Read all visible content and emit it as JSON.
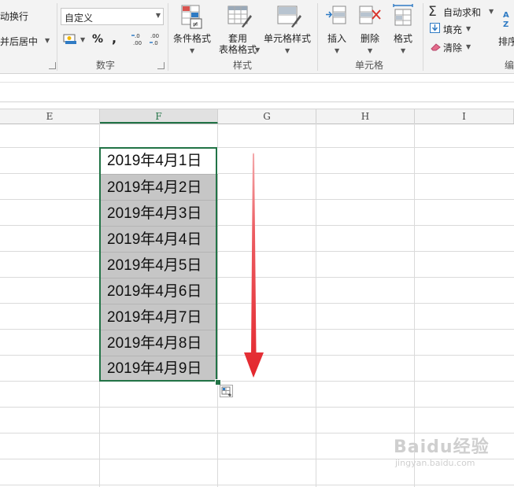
{
  "ribbon": {
    "alignment": {
      "wrap_text": "动换行",
      "merge_center": "并后居中"
    },
    "number": {
      "format_value": "自定义",
      "percent_symbol": "%",
      "comma_symbol": ",",
      "increase_decimal": "←.0\n.00",
      "decrease_decimal": ".00\n→.0",
      "group_label": "数字"
    },
    "styles": {
      "conditional_format": "条件格式",
      "format_as_table_line1": "套用",
      "format_as_table_line2": "表格格式",
      "cell_styles": "单元格样式",
      "group_label": "样式"
    },
    "cells": {
      "insert": "插入",
      "delete": "删除",
      "format": "格式",
      "group_label": "单元格"
    },
    "editing": {
      "autosum": "自动求和",
      "fill": "填充",
      "clear": "清除",
      "sort": "排序",
      "group_label_partial": "编"
    }
  },
  "columns": [
    {
      "label": "E",
      "selected": false
    },
    {
      "label": "F",
      "selected": true
    },
    {
      "label": "G",
      "selected": false
    },
    {
      "label": "H",
      "selected": false
    },
    {
      "label": "I",
      "selected": false
    }
  ],
  "cells": [
    "2019年4月1日",
    "2019年4月2日",
    "2019年4月3日",
    "2019年4月4日",
    "2019年4月5日",
    "2019年4月6日",
    "2019年4月7日",
    "2019年4月8日",
    "2019年4月9日"
  ],
  "colors": {
    "accent_green": "#217346",
    "selection_fill": "#c6c6c6",
    "arrow_red": "#e8343a"
  },
  "icons": {
    "autofill_options": "autofill-options-icon",
    "arrow": "down-arrow-annotation"
  },
  "watermark": {
    "line1": "Baidu经验",
    "line2": "jingyan.baidu.com"
  }
}
